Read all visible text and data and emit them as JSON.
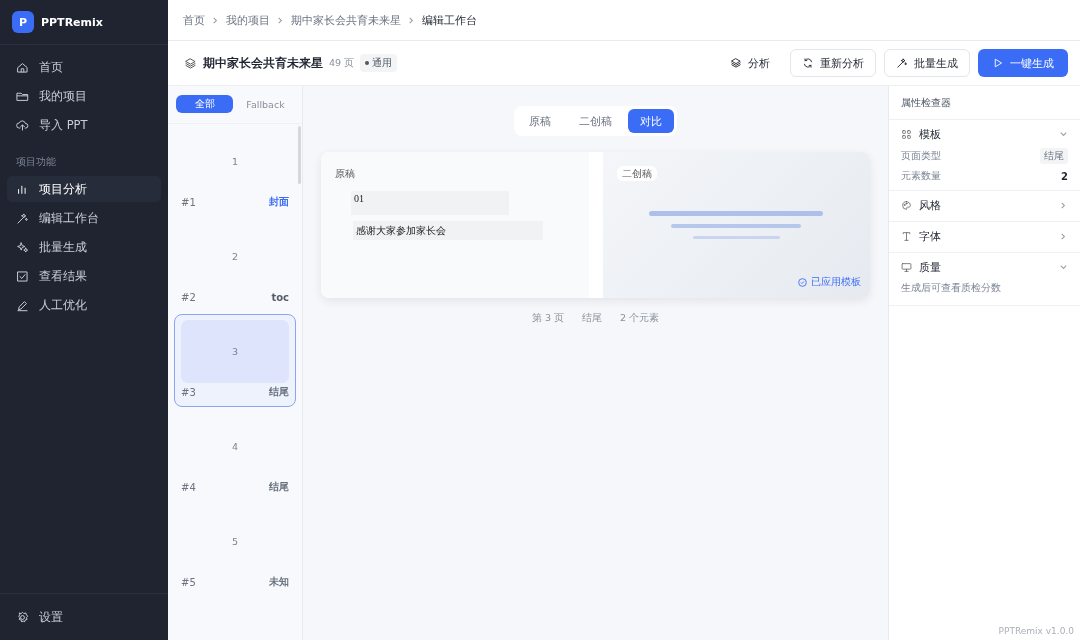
{
  "sidebar": {
    "brand": {
      "logo": "P",
      "name": "PPTRemix"
    },
    "items": [
      {
        "label": "首页",
        "selected": false
      },
      {
        "label": "我的项目",
        "selected": false
      },
      {
        "label": "导入 PPT",
        "selected": false
      }
    ],
    "section": "项目功能",
    "tools": [
      {
        "label": "项目分析",
        "selected": true
      },
      {
        "label": "编辑工作台",
        "selected": false
      },
      {
        "label": "批量生成",
        "selected": false
      },
      {
        "label": "查看结果",
        "selected": false
      },
      {
        "label": "人工优化",
        "selected": false
      }
    ],
    "settings": "设置"
  },
  "breadcrumb": [
    "首页",
    "我的项目",
    "期中家长会共育未来星",
    "编辑工作台"
  ],
  "header": {
    "title": "期中家长会共育未来星",
    "pages": "49 页",
    "badge": "通用",
    "buttons": [
      {
        "label": "分析",
        "kind": "plain"
      },
      {
        "label": "重新分析",
        "kind": "outline"
      },
      {
        "label": "批量生成",
        "kind": "outline"
      },
      {
        "label": "一键生成",
        "kind": "primary"
      }
    ]
  },
  "filters": [
    {
      "label": "全部",
      "selected": true
    },
    {
      "label": "Fallback",
      "selected": false
    }
  ],
  "slides": [
    {
      "number": "1",
      "index": "#1",
      "tag": "封面",
      "color": "#3b6cf6",
      "selected": false
    },
    {
      "number": "2",
      "index": "#2",
      "tag": "toc",
      "color": "#555c68",
      "selected": false
    },
    {
      "number": "3",
      "index": "#3",
      "tag": "结尾",
      "color": "#6b7280",
      "selected": true
    },
    {
      "number": "4",
      "index": "#4",
      "tag": "结尾",
      "color": "#6b7280",
      "selected": false
    },
    {
      "number": "5",
      "index": "#5",
      "tag": "未知",
      "color": "#6b7280",
      "selected": false
    }
  ],
  "view_tabs": [
    {
      "label": "原稿",
      "selected": false
    },
    {
      "label": "二创稿",
      "selected": false
    },
    {
      "label": "对比",
      "selected": true
    }
  ],
  "compare": {
    "original": {
      "label": "原稿",
      "elements": [
        "01",
        "感谢大家参加家长会"
      ]
    },
    "remix": {
      "label": "二创稿",
      "badge": "已应用模板"
    }
  },
  "footer": [
    "第 3 页",
    "结尾",
    "2 个元素"
  ],
  "inspector": {
    "title": "属性检查器",
    "sections": [
      {
        "title": "模板",
        "expanded": true,
        "rows": [
          {
            "label": "页面类型",
            "value": "结尾",
            "kind": "tag"
          },
          {
            "label": "元素数量",
            "value": "2",
            "kind": "number"
          }
        ]
      },
      {
        "title": "风格",
        "expanded": false
      },
      {
        "title": "字体",
        "expanded": false
      },
      {
        "title": "质量",
        "expanded": true,
        "note": "生成后可查看质检分数"
      }
    ]
  },
  "version": "PPTRemix v1.0.0"
}
